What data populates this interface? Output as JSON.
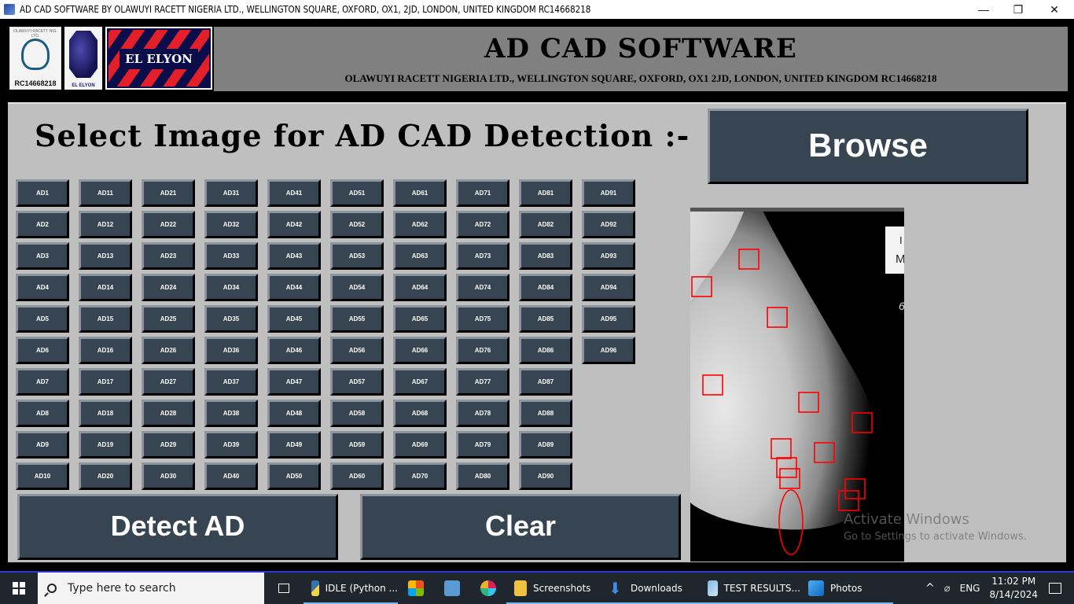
{
  "window": {
    "title": "AD CAD SOFTWARE BY OLAWUYI RACETT NIGERIA LTD., WELLINGTON SQUARE, OXFORD, OX1, 2JD, LONDON, UNITED KINGDOM RC14668218",
    "controls": {
      "minimize": "—",
      "maximize": "❐",
      "close": "✕"
    }
  },
  "banner": {
    "logo1_reg": "RC14668218",
    "logo1_small": "OLAWUYI RACETT NIG. LTD.",
    "logo2_label": "EL ELYON",
    "logo3_text": "EL ELYON",
    "title": "AD CAD SOFTWARE",
    "subtitle": "OLAWUYI RACETT NIGERIA LTD., WELLINGTON SQUARE, OXFORD, OX1 2JD, LONDON, UNITED KINGDOM RC14668218"
  },
  "main": {
    "heading": "Select Image for AD CAD Detection :-",
    "browse_label": "Browse",
    "detect_label": "Detect AD",
    "clear_label": "Clear",
    "image_buttons": [
      [
        "AD1",
        "AD11",
        "AD21",
        "AD31",
        "AD41",
        "AD51",
        "AD61",
        "AD71",
        "AD81",
        "AD91"
      ],
      [
        "AD2",
        "AD12",
        "AD22",
        "AD32",
        "AD42",
        "AD52",
        "AD62",
        "AD72",
        "AD82",
        "AD92"
      ],
      [
        "AD3",
        "AD13",
        "AD23",
        "AD33",
        "AD43",
        "AD53",
        "AD63",
        "AD73",
        "AD83",
        "AD93"
      ],
      [
        "AD4",
        "AD14",
        "AD24",
        "AD34",
        "AD44",
        "AD54",
        "AD64",
        "AD74",
        "AD84",
        "AD94"
      ],
      [
        "AD5",
        "AD15",
        "AD25",
        "AD35",
        "AD45",
        "AD55",
        "AD65",
        "AD75",
        "AD85",
        "AD95"
      ],
      [
        "AD6",
        "AD16",
        "AD26",
        "AD36",
        "AD46",
        "AD56",
        "AD66",
        "AD76",
        "AD86",
        "AD96"
      ],
      [
        "AD7",
        "AD17",
        "AD27",
        "AD37",
        "AD47",
        "AD57",
        "AD67",
        "AD77",
        "AD87"
      ],
      [
        "AD8",
        "AD18",
        "AD28",
        "AD38",
        "AD48",
        "AD58",
        "AD68",
        "AD78",
        "AD88"
      ],
      [
        "AD9",
        "AD19",
        "AD29",
        "AD39",
        "AD49",
        "AD59",
        "AD69",
        "AD79",
        "AD89"
      ],
      [
        "AD10",
        "AD20",
        "AD30",
        "AD40",
        "AD50",
        "AD60",
        "AD70",
        "AD80",
        "AD90"
      ]
    ],
    "image_label_fragment": [
      "I",
      "M",
      "6"
    ],
    "detection_color": "#ff0000",
    "button_color": "#374451",
    "panel_color": "#bfbfbf"
  },
  "watermark": {
    "line1": "Activate Windows",
    "line2": "Go to Settings to activate Windows."
  },
  "taskbar": {
    "search_placeholder": "Type here to search",
    "items": [
      {
        "label": "IDLE (Python ...",
        "icon": "python-idle-icon",
        "active": true
      },
      {
        "label": "",
        "icon": "microsoft-store-icon"
      },
      {
        "label": "",
        "icon": "remote-desktop-icon"
      },
      {
        "label": "",
        "icon": "slack-icon"
      },
      {
        "label": "Screenshots",
        "icon": "folder-icon",
        "active": true
      },
      {
        "label": "Downloads",
        "icon": "download-icon",
        "active": true
      },
      {
        "label": "TEST RESULTS...",
        "icon": "notepad-icon",
        "active": true
      },
      {
        "label": "Photos",
        "icon": "photos-icon",
        "active": true
      }
    ],
    "tray": {
      "language": "ENG",
      "time": "11:02 PM",
      "date": "8/14/2024"
    }
  }
}
